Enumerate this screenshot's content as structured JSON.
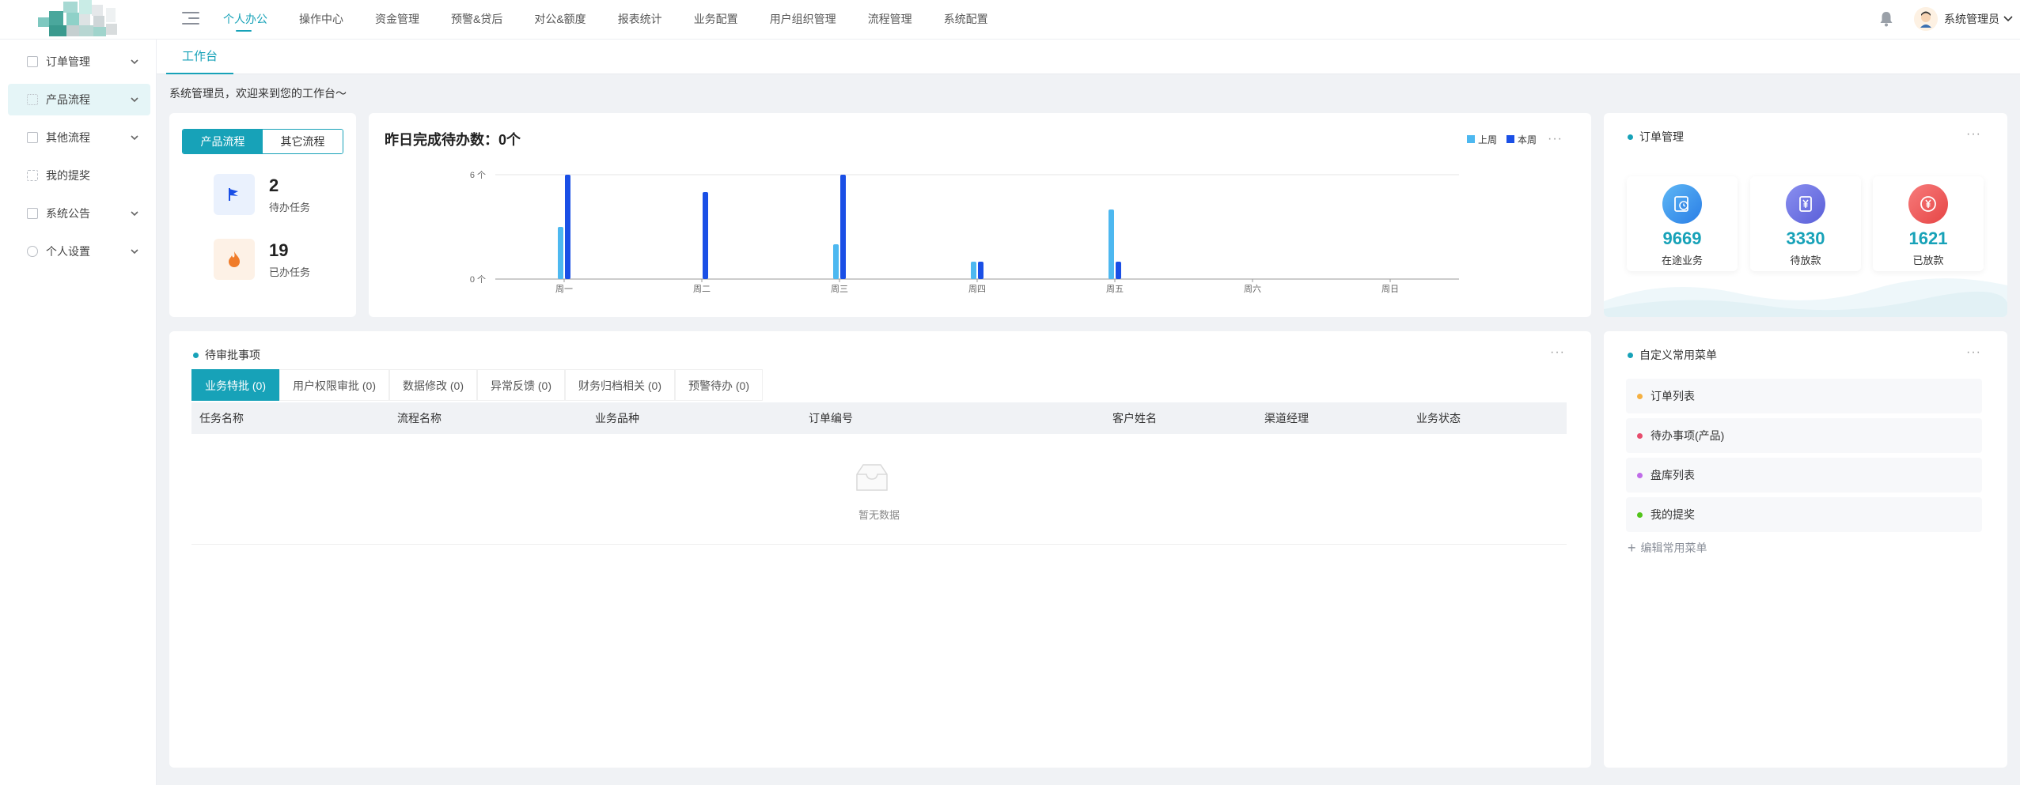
{
  "colors": {
    "accent": "#17a2b8",
    "last_week": "#4db8f0",
    "this_week": "#1a4fe6"
  },
  "nav": {
    "items": [
      "个人办公",
      "操作中心",
      "资金管理",
      "预警&贷后",
      "对公&额度",
      "报表统计",
      "业务配置",
      "用户组织管理",
      "流程管理",
      "系统配置"
    ],
    "active_index": 0
  },
  "user": {
    "name": "系统管理员"
  },
  "sidebar": {
    "items": [
      {
        "label": "订单管理",
        "icon": "order-icon",
        "has_children": true
      },
      {
        "label": "产品流程",
        "icon": "grid-icon",
        "has_children": true
      },
      {
        "label": "其他流程",
        "icon": "doc-icon",
        "has_children": true
      },
      {
        "label": "我的提奖",
        "icon": "list-icon",
        "has_children": false
      },
      {
        "label": "系统公告",
        "icon": "notice-icon",
        "has_children": true
      },
      {
        "label": "个人设置",
        "icon": "settings-icon",
        "has_children": true
      }
    ],
    "active_index": 1
  },
  "tabs": {
    "active": "工作台"
  },
  "welcome": "系统管理员，欢迎来到您的工作台～",
  "flow_card": {
    "toggle": [
      "产品流程",
      "其它流程"
    ],
    "pending": {
      "value": "2",
      "label": "待办任务"
    },
    "done": {
      "value": "19",
      "label": "已办任务"
    }
  },
  "chart_card": {
    "title": "昨日完成待办数：",
    "count": "0个",
    "legend": [
      "上周",
      "本周"
    ]
  },
  "chart_data": {
    "type": "bar",
    "categories": [
      "周一",
      "周二",
      "周三",
      "周四",
      "周五",
      "周六",
      "周日"
    ],
    "series": [
      {
        "name": "上周",
        "values": [
          3,
          0,
          2,
          1,
          4,
          0,
          0
        ]
      },
      {
        "name": "本周",
        "values": [
          6,
          5,
          6,
          1,
          1,
          0,
          0
        ]
      }
    ],
    "ylim": [
      0,
      6
    ],
    "y_ticks": [
      "0 个",
      "6 个"
    ]
  },
  "order_card": {
    "title": "订单管理",
    "items": [
      {
        "value": "9669",
        "label": "在途业务",
        "icon": "clock-doc-icon"
      },
      {
        "value": "3330",
        "label": "待放款",
        "icon": "yuan-card-icon"
      },
      {
        "value": "1621",
        "label": "已放款",
        "icon": "yuan-circle-icon"
      }
    ]
  },
  "pending_card": {
    "title": "待审批事项",
    "tabs": [
      "业务特批 (0)",
      "用户权限审批 (0)",
      "数据修改 (0)",
      "异常反馈 (0)",
      "财务归档相关 (0)",
      "预警待办 (0)"
    ],
    "active_tab": 0,
    "columns": [
      "任务名称",
      "流程名称",
      "业务品种",
      "订单编号",
      "客户姓名",
      "渠道经理",
      "业务状态"
    ],
    "empty_text": "暂无数据"
  },
  "shortcut_card": {
    "title": "自定义常用菜单",
    "items": [
      {
        "label": "订单列表",
        "color": "#f5b041"
      },
      {
        "label": "待办事项(产品)",
        "color": "#e74c6c"
      },
      {
        "label": "盘库列表",
        "color": "#c06ce8"
      },
      {
        "label": "我的提奖",
        "color": "#52c41a"
      }
    ],
    "edit_label": "编辑常用菜单"
  }
}
